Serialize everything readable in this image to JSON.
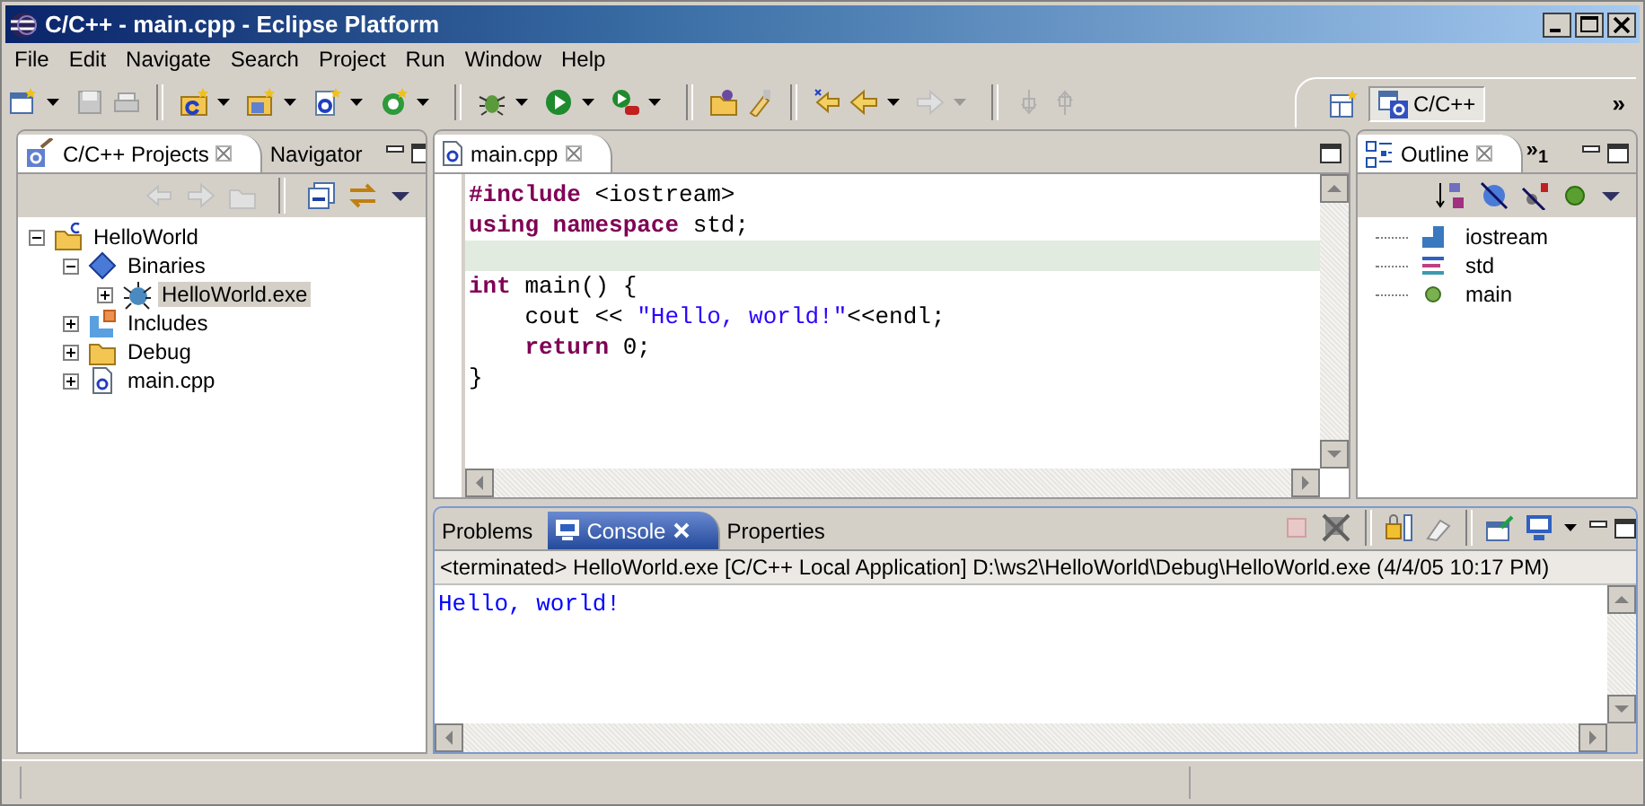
{
  "window": {
    "title": "C/C++ - main.cpp - Eclipse Platform"
  },
  "menu": [
    {
      "label": "File"
    },
    {
      "label": "Edit"
    },
    {
      "label": "Navigate"
    },
    {
      "label": "Search"
    },
    {
      "label": "Project"
    },
    {
      "label": "Run"
    },
    {
      "label": "Window"
    },
    {
      "label": "Help"
    }
  ],
  "perspective_bar": {
    "perspectives": [
      {
        "label": "C/C++",
        "selected": true
      }
    ],
    "overflow": "»"
  },
  "projects_view": {
    "focused": false,
    "tabs": [
      {
        "label": "C/C++ Projects",
        "selected": true
      },
      {
        "label": "Navigator",
        "selected": false
      }
    ],
    "tree": [
      {
        "label": "HelloWorld",
        "kind": "project",
        "expanded": true,
        "selected": false,
        "children": [
          {
            "label": "Binaries",
            "kind": "binaries",
            "expanded": true,
            "selected": false,
            "children": [
              {
                "label": "HelloWorld.exe",
                "kind": "executable",
                "expanded": false,
                "selected": true
              }
            ]
          },
          {
            "label": "Includes",
            "kind": "includes",
            "expanded": false,
            "selected": false
          },
          {
            "label": "Debug",
            "kind": "folder",
            "expanded": false,
            "selected": false
          },
          {
            "label": "main.cpp",
            "kind": "source",
            "expanded": false,
            "selected": false
          }
        ]
      }
    ]
  },
  "editor": {
    "focused": false,
    "tabs": [
      {
        "label": "main.cpp",
        "selected": true
      }
    ],
    "lines": [
      {
        "current": false,
        "tokens": [
          {
            "kind": "keyword",
            "text": "#include"
          },
          {
            "kind": "plain",
            "text": " <iostream>"
          }
        ]
      },
      {
        "current": false,
        "tokens": [
          {
            "kind": "keyword",
            "text": "using namespace"
          },
          {
            "kind": "plain",
            "text": " std;"
          }
        ]
      },
      {
        "current": true
      },
      {
        "current": false,
        "tokens": [
          {
            "kind": "keyword",
            "text": "int"
          },
          {
            "kind": "plain",
            "text": " main() {"
          }
        ]
      },
      {
        "current": false,
        "indent": true,
        "tokens": [
          {
            "kind": "plain",
            "text": "cout << "
          },
          {
            "kind": "string",
            "text": "\"Hello, world!\""
          },
          {
            "kind": "plain",
            "text": "<<endl;"
          }
        ]
      },
      {
        "current": false,
        "indent": true,
        "tokens": [
          {
            "kind": "keyword",
            "text": "return"
          },
          {
            "kind": "plain",
            "text": " 0;"
          }
        ]
      },
      {
        "current": false,
        "tokens": [
          {
            "kind": "plain",
            "text": "}"
          }
        ]
      }
    ]
  },
  "outline_view": {
    "focused": false,
    "tabs": [
      {
        "label": "Outline",
        "selected": true
      }
    ],
    "overflow": "»$_{1}$",
    "items": [
      {
        "label": "iostream",
        "kind": "include"
      },
      {
        "label": "std",
        "kind": "namespace"
      },
      {
        "label": "main",
        "kind": "function"
      }
    ]
  },
  "console_view": {
    "focused": true,
    "tabs": [
      {
        "label": "Problems",
        "selected": false
      },
      {
        "label": "Console",
        "selected": true
      },
      {
        "label": "Properties",
        "selected": false
      }
    ],
    "header": "<terminated> HelloWorld.exe [C/C++ Local Application] D:\\ws2\\HelloWorld\\Debug\\HelloWorld.exe (4/4/05 10:17 PM)",
    "output": "Hello, world!"
  }
}
